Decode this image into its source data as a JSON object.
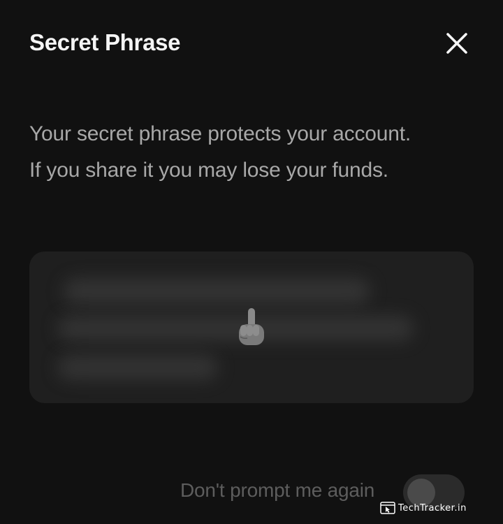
{
  "dialog": {
    "title": "Secret Phrase",
    "close_icon": "close-icon"
  },
  "warning": {
    "line1": "Your secret phrase protects your account.",
    "line2": "If you share it you may lose your funds."
  },
  "phrase_card": {
    "state": "hidden",
    "reveal_icon": "pointing-finger-icon"
  },
  "footer": {
    "dont_prompt_label": "Don't prompt me again",
    "toggle_on": false
  },
  "watermark": {
    "text": "TechTracker.in",
    "icon": "browser-cursor-icon"
  },
  "colors": {
    "background": "#111111",
    "card": "#1f1f1f",
    "title": "#f5f5f5",
    "body_text": "#a8a8a8",
    "muted_text": "#5d5d5d"
  }
}
